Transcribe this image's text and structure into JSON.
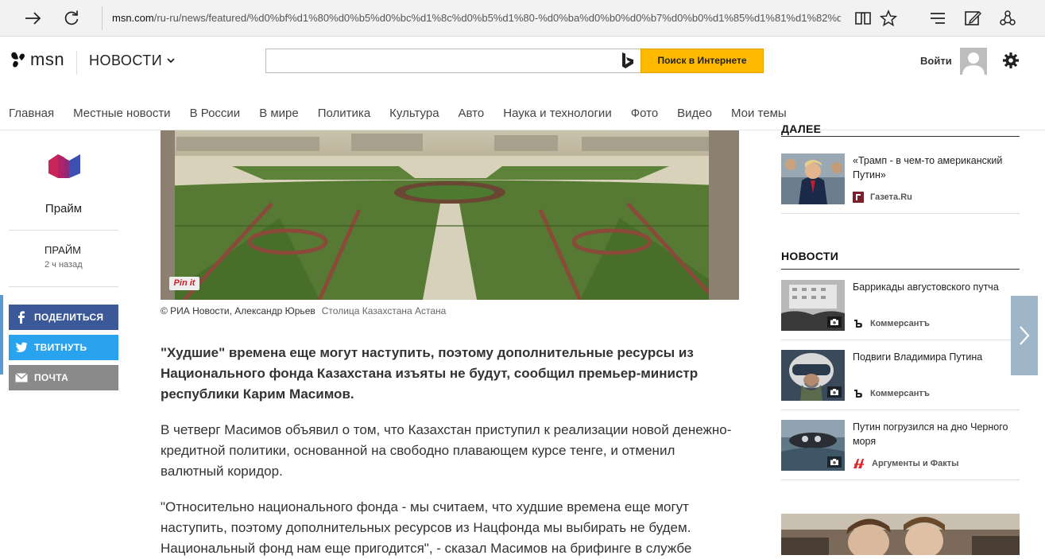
{
  "browser": {
    "url_host": "msn.com",
    "url_path": "/ru-ru/news/featured/%d0%bf%d1%80%d0%b5%d0%bc%d1%8c%d0%b5%d1%80-%d0%ba%d0%b0%d0%b7%d0%b0%d1%85%d1%81%d1%82%d0%"
  },
  "header": {
    "logo_text": "msn",
    "section": "НОВОСТИ",
    "search_placeholder": "",
    "search_button": "Поиск в Интернете",
    "login": "Войти"
  },
  "nav": {
    "items": [
      "Главная",
      "Местные новости",
      "В России",
      "В мире",
      "Политика",
      "Культура",
      "Авто",
      "Наука и технологии",
      "Фото",
      "Видео",
      "Мои темы"
    ]
  },
  "source": {
    "name": "Прайм",
    "author": "ПРАЙМ",
    "time_ago": "2 ч назад"
  },
  "share": {
    "facebook": "ПОДЕЛИТЬСЯ",
    "twitter": "ТВИТНУТЬ",
    "mail": "ПОЧТА"
  },
  "article": {
    "pinit": "Pin it",
    "photo_credit": "© РИА Новости, Александр Юрьев",
    "photo_caption": "Столица Казахстана Астана",
    "lead": "\"Худшие\" времена еще могут наступить, поэтому дополнительные ресурсы из Национального фонда Казахстана изъяты не будут, сообщил премьер-министр республики Карим Масимов.",
    "p1": "В четверг Масимов объявил о том, что Казахстан приступил к реализации новой денежно-кредитной политики, основанной на свободно плавающем курсе тенге, и отменил валютный коридор.",
    "p2": "\"Относительно национального фонда - мы считаем, что худшие времена еще могут наступить, поэтому дополнительных ресурсов из Нацфонда мы выбирать не будем. Национальный фонд нам еще пригодится\", - сказал Масимов на брифинге в службе"
  },
  "right": {
    "top_heading": "ДАЛЕЕ",
    "top_card": {
      "title": "«Трамп - в чем-то американский Путин»",
      "source": "Газета.Ru"
    },
    "news_heading": "НОВОСТИ",
    "cards": [
      {
        "title": "Баррикады августовского путча",
        "source": "Коммерсантъ"
      },
      {
        "title": "Подвиги Владимира Путина",
        "source": "Коммерсантъ"
      },
      {
        "title": "Путин погрузился на дно Черного моря",
        "source": "Аргументы и Факты"
      }
    ]
  },
  "colors": {
    "search_button": "#ffb900",
    "facebook": "#3b5998",
    "twitter": "#2aa3ef",
    "mail": "#8a8a8a"
  }
}
